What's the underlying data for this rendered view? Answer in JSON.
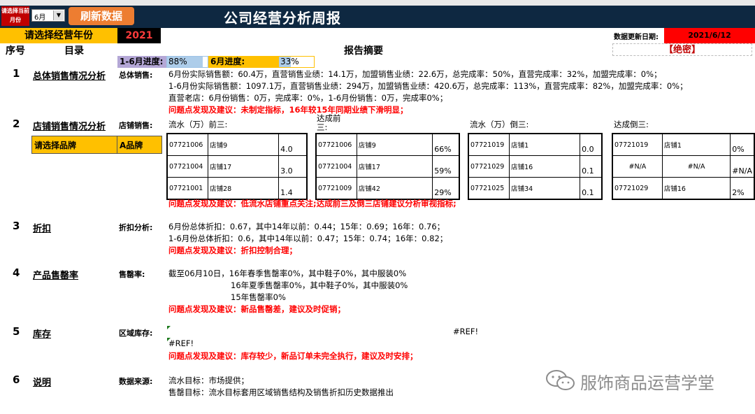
{
  "header": {
    "title": "公司经营分析周报",
    "month_label": "请选择当前月份",
    "month_value": "6月",
    "refresh_label": "刷新数据",
    "year_label": "请选择经营年份",
    "year_value": "2021",
    "update_label": "数据更新日期:",
    "update_value": "2021/6/12"
  },
  "columns": {
    "seq": "序号",
    "toc": "目录",
    "summary": "报告摘要",
    "secret": "【绝密】"
  },
  "progress": {
    "ytd_label": "1-6月进度:",
    "ytd_value": "88%",
    "ytd_fraction": 0.88,
    "month_label": "6月进度:",
    "month_value": "33%",
    "month_fraction": 0.33
  },
  "sections": {
    "s1": {
      "num": "1",
      "title": "总体销售情况分析",
      "sub": "总体销售:",
      "lines": [
        "6月份实际销售额：60.4万，直营销售业绩：14.1万，加盟销售业绩：22.6万，总完成率：50%，直营完成率：32%，加盟完成率：0%；",
        "1-6月份实际销售额：1097.1万，直营销售业绩：294万，加盟销售业绩：420.6万，总完成率：113%，直营完成率：82%，加盟完成率：0%；",
        "直营老店：6月份销售：0万，完成率：0%，1-6月份销售：0万，完成率0%；"
      ],
      "issue": "问题点发现及建议：未制定指标，16年较15年同期业绩下滑明显；"
    },
    "s2": {
      "num": "2",
      "title": "店铺销售情况分析",
      "sub": "店铺销售:",
      "brand_label": "请选择品牌",
      "brand_value": "A品牌",
      "top_flow_title": "流水（万）前三:",
      "top_rate_title": "达成前三:",
      "bottom_flow_title": "流水（万）倒三:",
      "bottom_rate_title": "达成倒三:",
      "top_flow": [
        [
          "07721006",
          "店铺9",
          "4.0"
        ],
        [
          "07721004",
          "店铺17",
          "3.0"
        ],
        [
          "07721001",
          "店铺28",
          "1.4"
        ]
      ],
      "top_rate": [
        [
          "07721006",
          "店铺9",
          "66%"
        ],
        [
          "07721004",
          "店铺17",
          "59%"
        ],
        [
          "07721009",
          "店铺42",
          "29%"
        ]
      ],
      "bottom_flow": [
        [
          "07721019",
          "店铺1",
          "0.0"
        ],
        [
          "07721029",
          "店铺16",
          "0.1"
        ],
        [
          "07721025",
          "店铺34",
          "0.1"
        ]
      ],
      "bottom_rate": [
        [
          "07721019",
          "店铺1",
          "0%"
        ],
        [
          "#N/A",
          "#N/A",
          "#N/A"
        ],
        [
          "07721029",
          "店铺16",
          "2%"
        ]
      ],
      "issue": "问题点发现及建议：低流水店铺重点关注;达成前三及倒三店铺建议分析审视指标;"
    },
    "s3": {
      "num": "3",
      "title": "折扣",
      "sub": "折扣分析:",
      "lines": [
        "6月份总体折扣：0.67，其中14年以前：0.44；15年：0.69；16年：0.76；",
        "1-6月份总体折扣：0.6，其中14年以前：0.47；15年：0.74；16年：0.82；"
      ],
      "issue": "问题点发现及建议：折扣控制合理；"
    },
    "s4": {
      "num": "4",
      "title": "产品售罄率",
      "sub": "售罄率:",
      "lines": [
        "截至06月10日，16年春季售罄率0%，其中鞋子0%，其中服装0%",
        "16年夏季售罄率0%，其中鞋子0%，其中服装0%",
        "15年售罄率0%"
      ],
      "issue": "问题点发现及建议：新品售罄差，建议及时促销；"
    },
    "s5": {
      "num": "5",
      "title": "库存",
      "sub": "区域库存:",
      "ref_left": "#REF!",
      "ref_right": "#REF!",
      "issue": "问题点发现及建议：库存较少，新品订单未完全执行，建议及时安排；"
    },
    "s6": {
      "num": "6",
      "title": "说明",
      "sub": "数据来源:",
      "lines": [
        "流水目标：市场提供；",
        "售罄目标：流水目标套用区域销售结构及销售折扣历史数据推出"
      ]
    }
  },
  "watermark": "服饰商品运营学堂",
  "colors": {
    "title_bg": "#0e2841",
    "accent": "#ffc000",
    "alert": "#ff0000",
    "button": "#ed7d31"
  }
}
